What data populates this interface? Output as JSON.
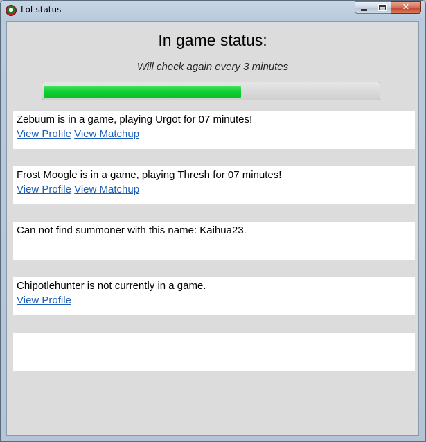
{
  "window": {
    "title": "Lol-status",
    "app_icon": "lol-status-app-icon",
    "caption_buttons": [
      "minimize",
      "maximize",
      "close"
    ],
    "close_glyph": "✕"
  },
  "main": {
    "heading": "In game status:",
    "subheading": "Will check again every 3 minutes",
    "progress": {
      "value": 0.59,
      "fill_color": "#0fcf2f"
    },
    "cards": [
      {
        "message": "Zebuum is in a game, playing Urgot for 07 minutes!",
        "links": [
          "View Profile",
          "View Matchup"
        ]
      },
      {
        "message": "Frost Moogle is in a game, playing Thresh for 07 minutes!",
        "links": [
          "View Profile",
          "View Matchup"
        ]
      },
      {
        "message": "Can not find summoner with this name: Kaihua23.",
        "links": []
      },
      {
        "message": "Chipotlehunter is not currently in a game.",
        "links": [
          "View Profile"
        ]
      },
      {
        "message": "",
        "links": []
      }
    ]
  }
}
